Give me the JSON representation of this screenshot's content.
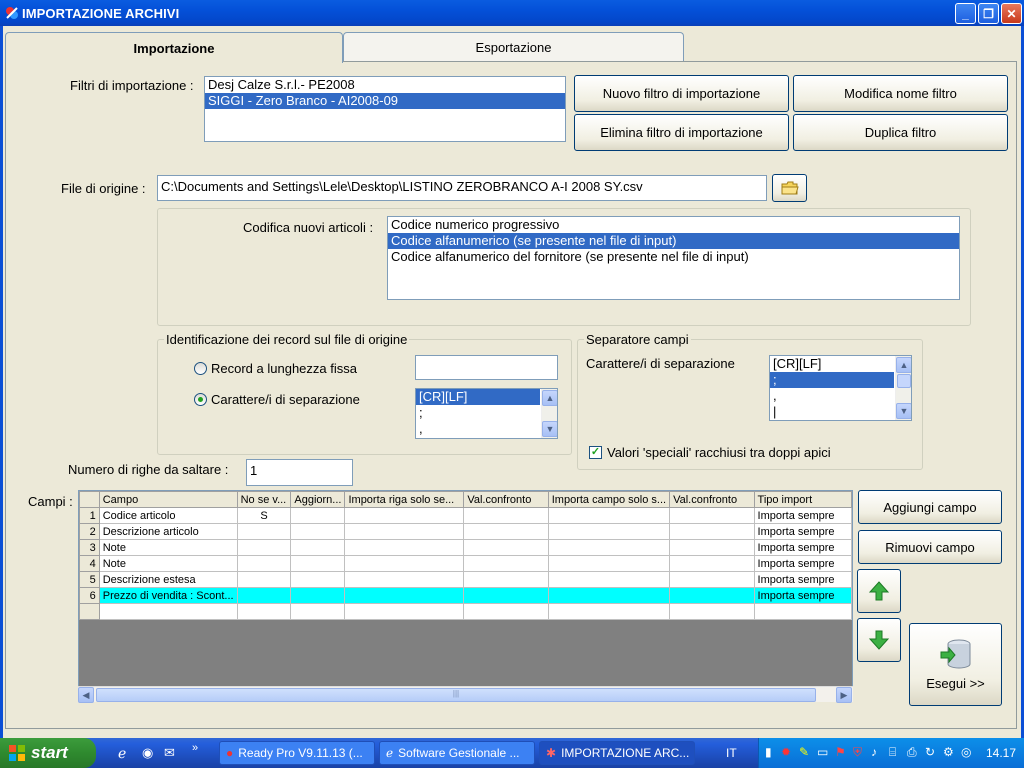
{
  "window": {
    "title": "IMPORTAZIONE ARCHIVI",
    "buttons": {
      "minimize": "_",
      "maximize": "❐",
      "close": "✕"
    }
  },
  "tabs": [
    {
      "label": "Importazione",
      "active": true
    },
    {
      "label": "Esportazione",
      "active": false
    }
  ],
  "filters": {
    "label": "Filtri di importazione :",
    "items": [
      {
        "text": "Desj Calze S.r.l.- PE2008",
        "selected": false
      },
      {
        "text": "SIGGI - Zero Branco - AI2008-09",
        "selected": true
      }
    ],
    "buttons": {
      "new": "Nuovo filtro di importazione",
      "rename": "Modifica nome filtro",
      "delete": "Elimina filtro di importazione",
      "duplicate": "Duplica filtro"
    }
  },
  "source_file": {
    "label": "File di origine :",
    "value": "C:\\Documents and Settings\\Lele\\Desktop\\LISTINO ZEROBRANCO A-I 2008 SY.csv"
  },
  "codifica": {
    "label": "Codifica nuovi articoli :",
    "items": [
      {
        "text": "Codice numerico progressivo",
        "selected": false
      },
      {
        "text": "Codice alfanumerico (se presente nel file di input)",
        "selected": true
      },
      {
        "text": "Codice alfanumerico del fornitore (se presente nel file di input)",
        "selected": false
      }
    ]
  },
  "record_id": {
    "title": "Identificazione dei record sul file di origine",
    "fixed_length_label": "Record a lunghezza fissa",
    "fixed_length_value": "",
    "separator_label": "Carattere/i di separazione",
    "separator_selected": true,
    "separator_items": [
      {
        "text": "[CR][LF]",
        "selected": true
      },
      {
        "text": ";",
        "selected": false
      },
      {
        "text": ",",
        "selected": false
      }
    ]
  },
  "field_sep": {
    "title": "Separatore campi",
    "label": "Carattere/i di separazione",
    "items": [
      {
        "text": "[CR][LF]",
        "selected": false
      },
      {
        "text": ";",
        "selected": true
      },
      {
        "text": ",",
        "selected": false
      },
      {
        "text": "|",
        "selected": false
      }
    ],
    "quotes_label": "Valori 'speciali' racchiusi tra doppi apici",
    "quotes_checked": true
  },
  "skip_rows": {
    "label": "Numero di righe da saltare :",
    "value": "1"
  },
  "campi": {
    "label": "Campi :",
    "columns": [
      "Campo",
      "No se v...",
      "Aggiorn...",
      "Importa riga solo se...",
      "Val.confronto",
      "Importa campo solo s...",
      "Val.confronto",
      "Tipo import"
    ],
    "rows": [
      {
        "n": "1",
        "cells": [
          "Codice articolo",
          "S",
          "",
          "",
          "",
          "",
          "",
          "Importa sempre"
        ],
        "highlight": false
      },
      {
        "n": "2",
        "cells": [
          "Descrizione articolo",
          "",
          "",
          "",
          "",
          "",
          "",
          "Importa sempre"
        ],
        "highlight": false
      },
      {
        "n": "3",
        "cells": [
          "Note",
          "",
          "",
          "",
          "",
          "",
          "",
          "Importa sempre"
        ],
        "highlight": false
      },
      {
        "n": "4",
        "cells": [
          "Note",
          "",
          "",
          "",
          "",
          "",
          "",
          "Importa sempre"
        ],
        "highlight": false
      },
      {
        "n": "5",
        "cells": [
          "Descrizione estesa",
          "",
          "",
          "",
          "",
          "",
          "",
          "Importa sempre"
        ],
        "highlight": false
      },
      {
        "n": "6",
        "cells": [
          "Prezzo di vendita : Scont...",
          "",
          "",
          "",
          "",
          "",
          "",
          "Importa sempre"
        ],
        "highlight": true
      }
    ],
    "buttons": {
      "add": "Aggiungi campo",
      "remove": "Rimuovi campo",
      "execute": "Esegui >>"
    }
  },
  "taskbar": {
    "start": "start",
    "tasks": [
      {
        "label": "Ready Pro V9.11.13 (...",
        "active": false
      },
      {
        "label": "Software Gestionale ...",
        "active": false
      },
      {
        "label": "IMPORTAZIONE ARC...",
        "active": true
      }
    ],
    "language": "IT",
    "clock": "14.17"
  },
  "colors": {
    "titlebar": "#0450d8",
    "selection": "#316ac5",
    "row_highlight": "#00ffff",
    "arrow_green": "#3cb043"
  }
}
